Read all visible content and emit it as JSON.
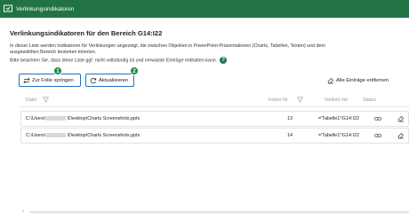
{
  "window": {
    "title": "Verlinkungsindikatoren"
  },
  "heading": "Verlinkungsindikatoren für den Bereich G14:I22",
  "description": {
    "line1": "In dieser Liste werden Indikatoren für Verlinkungen angezeigt, die zwischen Objekten in PowerPoint-Präsentationen (Charts, Tabellen, Texten) und dem",
    "line2": "ausgewählten Bereich bestehen könnten.",
    "line3": "Bitte beachten Sie, dass diese Liste ggf. nicht vollständig ist und verwaiste Einträge enthalten kann.",
    "help_glyph": "?"
  },
  "toolbar": {
    "goto_label": "Zur Folie springen",
    "refresh_label": "Aktualisieren",
    "remove_all_label": "Alle Einträge entfernen",
    "badge1": "1",
    "badge2": "2"
  },
  "table": {
    "columns": {
      "file": "Datei",
      "slide": "Folien-Nr.",
      "linked": "Verlinkt mit",
      "status": "Status"
    },
    "rows": [
      {
        "path_start": "C:\\Users\\",
        "path_end": "\\Desktop\\Charts Screenshots.pptx",
        "slide": "13",
        "linked": "='Tabelle1'!G14:I22"
      },
      {
        "path_start": "C:\\Users\\",
        "path_end": "\\Desktop\\Charts Screenshots.pptx",
        "slide": "14",
        "linked": "='Tabelle1'!G14:I22"
      }
    ]
  },
  "scrollbar": {
    "left_arrow": "‹"
  },
  "colors": {
    "titlebar": "#217346",
    "badge": "#1e8a4c",
    "focus_outline": "#1f70c1"
  }
}
